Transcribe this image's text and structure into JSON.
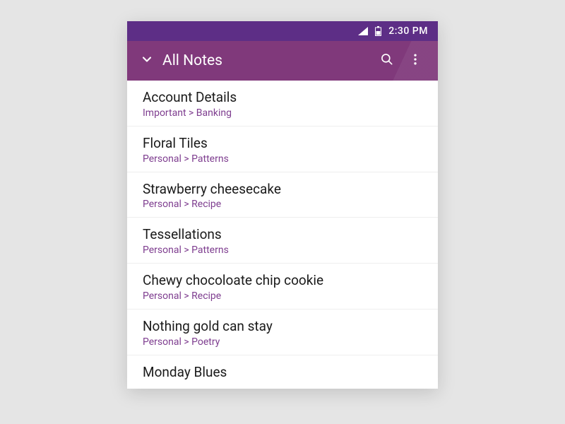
{
  "colors": {
    "statusbar": "#5d2e86",
    "appbar": "#80397b",
    "path": "#7e3d8f"
  },
  "statusbar": {
    "time": "2:30 PM"
  },
  "appbar": {
    "title": "All Notes"
  },
  "notes": [
    {
      "title": "Account Details",
      "path": "Important  >  Banking"
    },
    {
      "title": "Floral Tiles",
      "path": "Personal  >  Patterns"
    },
    {
      "title": "Strawberry cheesecake",
      "path": "Personal  >  Recipe"
    },
    {
      "title": "Tessellations",
      "path": "Personal  >  Patterns"
    },
    {
      "title": "Chewy chocoloate chip cookie",
      "path": "Personal  >  Recipe"
    },
    {
      "title": "Nothing gold can stay",
      "path": "Personal  >  Poetry"
    },
    {
      "title": "Monday Blues",
      "path": ""
    }
  ]
}
